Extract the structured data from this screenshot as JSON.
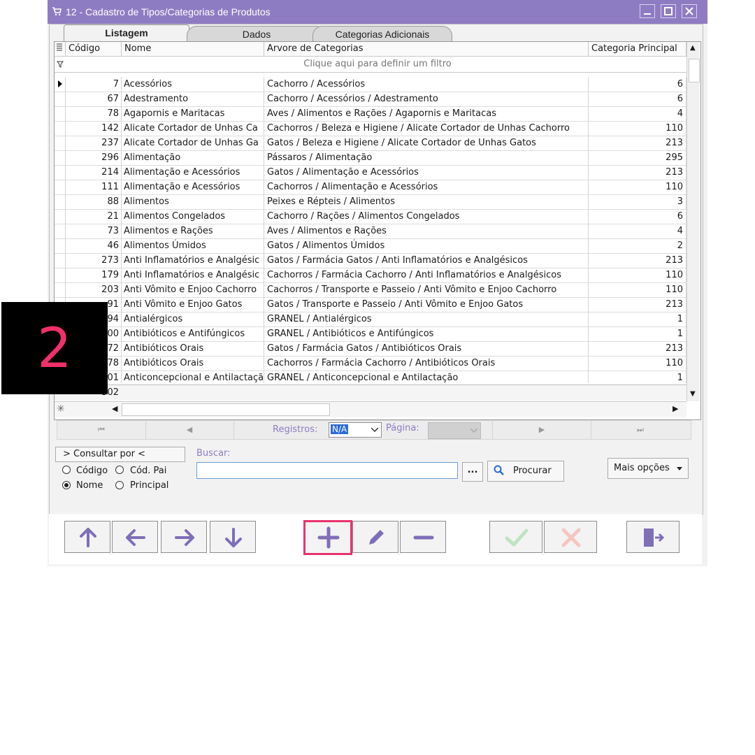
{
  "window": {
    "title": "12 - Cadastro de Tipos/Categorias de Produtos",
    "buttons": [
      "minimize",
      "maximize",
      "close"
    ]
  },
  "tabs": [
    {
      "label": "Listagem",
      "active": true
    },
    {
      "label": "Dados",
      "active": false
    },
    {
      "label": "Categorias Adicionais",
      "active": false
    }
  ],
  "grid": {
    "columns": [
      "Código",
      "Nome",
      "Arvore de Categorias",
      "Categoria Principal"
    ],
    "filter_hint": "Clique aqui para definir um filtro",
    "rows": [
      {
        "codigo": "7",
        "nome": "Acessórios",
        "arvore": "Cachorro / Acessórios",
        "principal": "6"
      },
      {
        "codigo": "67",
        "nome": "Adestramento",
        "arvore": "Cachorro / Acessórios / Adestramento",
        "principal": "6"
      },
      {
        "codigo": "78",
        "nome": "Agapornis e Maritacas",
        "arvore": "Aves / Alimentos e Rações / Agapornis e Maritacas",
        "principal": "4"
      },
      {
        "codigo": "142",
        "nome": "Alicate Cortador de Unhas Ca",
        "arvore": "Cachorros / Beleza e Higiene / Alicate Cortador de Unhas Cachorro",
        "principal": "110"
      },
      {
        "codigo": "237",
        "nome": "Alicate Cortador de Unhas Ga",
        "arvore": "Gatos / Beleza e Higiene / Alicate Cortador de Unhas Gatos",
        "principal": "213"
      },
      {
        "codigo": "296",
        "nome": "Alimentação",
        "arvore": "Pássaros / Alimentação",
        "principal": "295"
      },
      {
        "codigo": "214",
        "nome": "Alimentação e Acessórios",
        "arvore": "Gatos / Alimentação e Acessórios",
        "principal": "213"
      },
      {
        "codigo": "111",
        "nome": "Alimentação e Acessórios",
        "arvore": "Cachorros / Alimentação e Acessórios",
        "principal": "110"
      },
      {
        "codigo": "88",
        "nome": "Alimentos",
        "arvore": "Peixes e Répteis / Alimentos",
        "principal": "3"
      },
      {
        "codigo": "21",
        "nome": "Alimentos Congelados",
        "arvore": "Cachorro / Rações / Alimentos Congelados",
        "principal": "6"
      },
      {
        "codigo": "73",
        "nome": "Alimentos e Rações",
        "arvore": "Aves / Alimentos e Rações",
        "principal": "4"
      },
      {
        "codigo": "46",
        "nome": "Alimentos Úmidos",
        "arvore": "Gatos / Alimentos Úmidos",
        "principal": "2"
      },
      {
        "codigo": "273",
        "nome": "Anti Inflamatórios e Analgésic",
        "arvore": "Gatos / Farmácia Gatos / Anti Inflamatórios e Analgésicos",
        "principal": "213"
      },
      {
        "codigo": "179",
        "nome": "Anti Inflamatórios e Analgésic",
        "arvore": "Cachorros / Farmácia Cachorro / Anti Inflamatórios e Analgésicos",
        "principal": "110"
      },
      {
        "codigo": "203",
        "nome": "Anti Vômito e Enjoo Cachorro",
        "arvore": "Cachorros / Transporte e Passeio / Anti Vômito e Enjoo Cachorro",
        "principal": "110"
      },
      {
        "codigo": "91",
        "nome": "Anti Vômito e Enjoo Gatos",
        "arvore": "Gatos / Transporte e Passeio / Anti Vômito e Enjoo Gatos",
        "principal": "213"
      },
      {
        "codigo": "94",
        "nome": "Antialérgicos",
        "arvore": "GRANEL / Antialérgicos",
        "principal": "1"
      },
      {
        "codigo": "00",
        "nome": "Antibióticos e Antifúngicos",
        "arvore": "GRANEL / Antibióticos e Antifúngicos",
        "principal": "1"
      },
      {
        "codigo": "72",
        "nome": "Antibióticos Orais",
        "arvore": "Gatos / Farmácia Gatos / Antibióticos Orais",
        "principal": "213"
      },
      {
        "codigo": "78",
        "nome": "Antibióticos Orais",
        "arvore": "Cachorros / Farmácia Cachorro / Antibióticos Orais",
        "principal": "110"
      },
      {
        "codigo": "01",
        "nome": "Anticoncepcional e Antilactaçã",
        "arvore": "GRANEL / Anticoncepcional e Antilactação",
        "principal": "1"
      }
    ],
    "footer_count": "302"
  },
  "navigator": {
    "registros_label": "Registros:",
    "registros_value": "N/A",
    "pagina_label": "Página:"
  },
  "search": {
    "consultar_label": "> Consultar por <",
    "buscar_label": "Buscar:",
    "buscar_value": "",
    "ellipsis_label": "...",
    "procurar_label": "Procurar",
    "mais_opcoes_label": "Mais opções",
    "options": [
      {
        "label": "Código",
        "selected": false
      },
      {
        "label": "Cód. Pai",
        "selected": false
      },
      {
        "label": "Nome",
        "selected": true
      },
      {
        "label": "Principal",
        "selected": false
      }
    ]
  },
  "toolbar": {
    "buttons": [
      "first-record",
      "previous-record",
      "next-record",
      "last-record",
      "add-record",
      "edit-record",
      "delete-record",
      "confirm",
      "cancel",
      "exit"
    ],
    "highlighted": "add-record"
  },
  "annotation": {
    "step": "2"
  },
  "colors": {
    "accent": "#8e7cc3",
    "highlight": "#e8336d",
    "annotation_text": "#f0306a"
  }
}
